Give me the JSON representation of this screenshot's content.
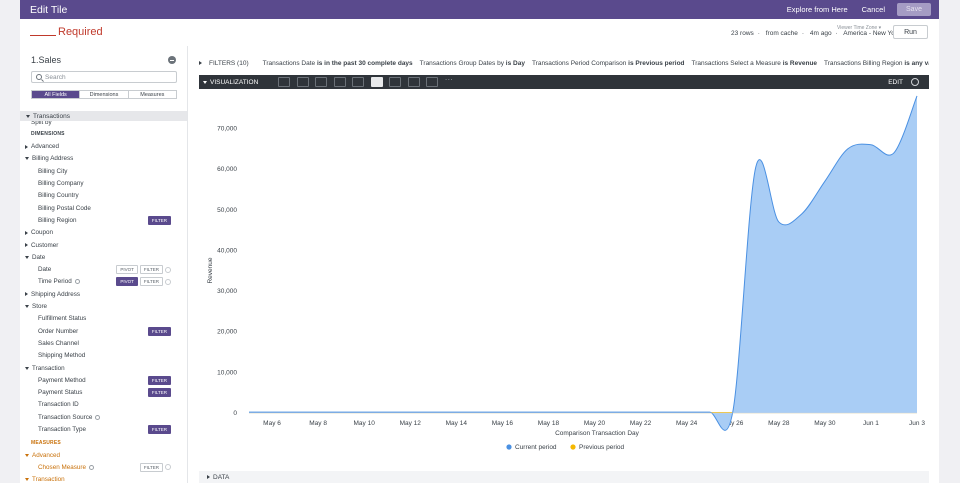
{
  "header": {
    "title": "Edit Tile",
    "explore_link": "Explore from Here",
    "cancel_label": "Cancel",
    "save_label": "Save"
  },
  "tile": {
    "title_suffix": "Required"
  },
  "meta": {
    "timezone_label": "Viewer Time Zone",
    "rows": "23 rows",
    "cache": "from cache",
    "age": "4m ago",
    "timezone": "America - New York",
    "run_label": "Run"
  },
  "sidebar": {
    "explore_name": "1.Sales",
    "search_placeholder": "Search",
    "tabs": [
      "All Fields",
      "Dimensions",
      "Measures"
    ],
    "view_name": "Transactions",
    "partial_row": "Split by",
    "dimensions_label": "DIMENSIONS",
    "measures_label": "MEASURES",
    "filter_tag": "FILTER",
    "pivot_tag": "PIVOT",
    "rows": [
      {
        "text": "Advanced",
        "kind": "group",
        "open": false
      },
      {
        "text": "Billing Address",
        "kind": "group",
        "open": true
      },
      {
        "text": "Billing City",
        "kind": "child"
      },
      {
        "text": "Billing Company",
        "kind": "child"
      },
      {
        "text": "Billing Country",
        "kind": "child"
      },
      {
        "text": "Billing Postal Code",
        "kind": "child"
      },
      {
        "text": "Billing Region",
        "kind": "child",
        "filter": "filled"
      },
      {
        "text": "Coupon",
        "kind": "group",
        "open": false
      },
      {
        "text": "Customer",
        "kind": "group",
        "open": false
      },
      {
        "text": "Date",
        "kind": "group",
        "open": true
      },
      {
        "text": "Date",
        "kind": "child",
        "pivot": "outline",
        "filter": "outline",
        "circle": true
      },
      {
        "text": "Time Period",
        "kind": "child",
        "info": true,
        "pivot": "filled",
        "filter": "outline",
        "circle": true
      },
      {
        "text": "Shipping Address",
        "kind": "group",
        "open": false
      },
      {
        "text": "Store",
        "kind": "group",
        "open": true
      },
      {
        "text": "Fulfillment Status",
        "kind": "child"
      },
      {
        "text": "Order Number",
        "kind": "child",
        "filter": "filled"
      },
      {
        "text": "Sales Channel",
        "kind": "child"
      },
      {
        "text": "Shipping Method",
        "kind": "child"
      },
      {
        "text": "Transaction",
        "kind": "group",
        "open": true
      },
      {
        "text": "Payment Method",
        "kind": "child",
        "filter": "filled"
      },
      {
        "text": "Payment Status",
        "kind": "child",
        "filter": "filled"
      },
      {
        "text": "Transaction ID",
        "kind": "child"
      },
      {
        "text": "Transaction Source",
        "kind": "child",
        "info": true
      },
      {
        "text": "Transaction Type",
        "kind": "child",
        "filter": "filled"
      }
    ],
    "measure_rows": [
      {
        "text": "Advanced",
        "kind": "group",
        "open": true
      },
      {
        "text": "Chosen Measure",
        "kind": "child",
        "info": true,
        "filter": "outline",
        "circle": true
      },
      {
        "text": "Transaction",
        "kind": "group",
        "open": true
      }
    ]
  },
  "filters": {
    "title": "FILTERS (10)",
    "items": [
      {
        "field": "Transactions Date",
        "op": "is in the past 30 complete days"
      },
      {
        "field": "Transactions Group Dates by",
        "op": "is Day"
      },
      {
        "field": "Transactions Period Comparison",
        "op": "is Previous period"
      },
      {
        "field": "Transactions Select a Measure",
        "op": "is Revenue"
      },
      {
        "field": "Transactions Billing Region",
        "op": "is any value"
      }
    ]
  },
  "visualization": {
    "title": "VISUALIZATION",
    "edit_label": "EDIT",
    "icons": [
      "table-icon",
      "column-chart-icon",
      "bar-chart-icon",
      "scatter-icon",
      "line-icon",
      "area-icon",
      "pie-icon",
      "map-icon",
      "single-value-icon",
      "more-icon"
    ],
    "active_icon": "area-icon",
    "more_glyph": "···"
  },
  "data_section": {
    "title": "DATA"
  },
  "chart_data": {
    "type": "area",
    "title": "",
    "xlabel": "Comparison Transaction Day",
    "ylabel": "Revenue",
    "ylim": [
      0,
      77000
    ],
    "yticks": [
      0,
      10000,
      20000,
      30000,
      40000,
      50000,
      60000,
      70000
    ],
    "ytick_labels": [
      "0",
      "10,000",
      "20,000",
      "30,000",
      "40,000",
      "50,000",
      "60,000",
      "70,000"
    ],
    "x": [
      "May 5",
      "May 6",
      "May 7",
      "May 8",
      "May 9",
      "May 10",
      "May 11",
      "May 12",
      "May 13",
      "May 14",
      "May 15",
      "May 16",
      "May 17",
      "May 18",
      "May 19",
      "May 20",
      "May 21",
      "May 22",
      "May 23",
      "May 24",
      "May 25",
      "May 26",
      "May 27",
      "May 28",
      "May 29",
      "May 30",
      "May 31",
      "Jun 1",
      "Jun 2",
      "Jun 3"
    ],
    "xtick_labels": [
      "May 6",
      "May 8",
      "May 10",
      "May 12",
      "May 14",
      "May 16",
      "May 18",
      "May 20",
      "May 22",
      "May 24",
      "May 26",
      "May 28",
      "May 30",
      "Jun 1",
      "Jun 3"
    ],
    "series": [
      {
        "name": "Current period",
        "color": "#4a90e2",
        "values": [
          200,
          200,
          200,
          200,
          200,
          200,
          200,
          200,
          200,
          200,
          200,
          200,
          200,
          200,
          200,
          200,
          200,
          200,
          200,
          200,
          200,
          200,
          60500,
          47000,
          49000,
          57000,
          65000,
          66000,
          64000,
          78000
        ]
      },
      {
        "name": "Previous period",
        "color": "#f5b800",
        "values": [
          100,
          100,
          100,
          100,
          100,
          100,
          100,
          100,
          100,
          100,
          100,
          100,
          100,
          100,
          100,
          100,
          100,
          100,
          100,
          100,
          100,
          100,
          100,
          100,
          100,
          100,
          100,
          100,
          100,
          100
        ]
      }
    ],
    "legend_position": "bottom-center",
    "grid": false
  }
}
